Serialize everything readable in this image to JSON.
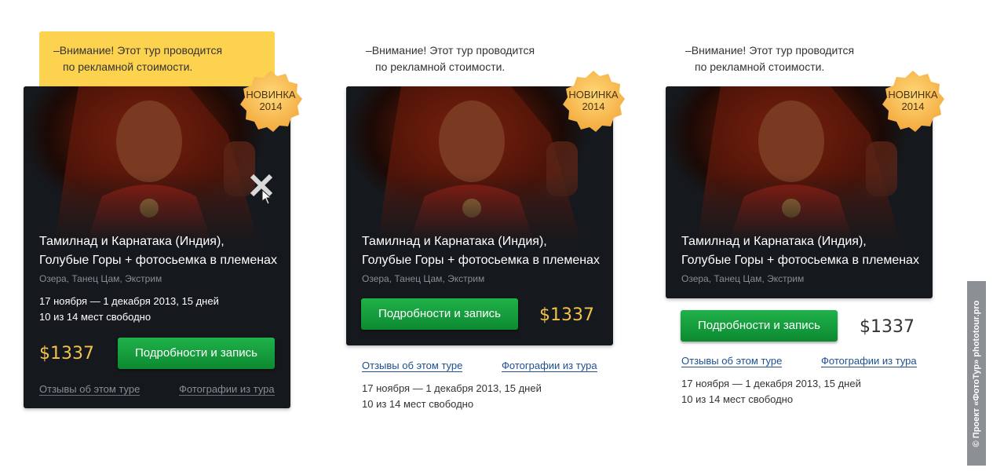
{
  "notice": {
    "line1": "–Внимание! Этот тур проводится",
    "line2": "по рекламной стоимости."
  },
  "badge": {
    "line1": "НОВИНКА",
    "line2": "2014"
  },
  "tour": {
    "title_line1": "Тамилнад и Карнатака (Индия),",
    "title_line2": "Голубые Горы + фотосьемка в племенах",
    "tags": "Озера, Танец Цам, Экстрим",
    "dates": "17 ноября — 1 декабря 2013, 15 дней",
    "seats": "10 из 14 мест свободно",
    "price": "$1337",
    "button": "Подробности и запись",
    "reviews_link": "Отзывы об этом туре",
    "photos_link": "Фотографии из тура"
  },
  "vertical_caption": "© Проект «ФотоТур» phototour.pro",
  "colors": {
    "card_bg": "#15181c",
    "button_green": "#18a33d",
    "price_gold": "#f3c24b",
    "notice_yellow": "#fcd24f",
    "link_blue": "#1c4f8f",
    "badge_orange": "#f6b347"
  },
  "icons": {
    "badge": "new-badge-icon",
    "cursor": "hand-cursor-icon",
    "close": "close-icon"
  }
}
